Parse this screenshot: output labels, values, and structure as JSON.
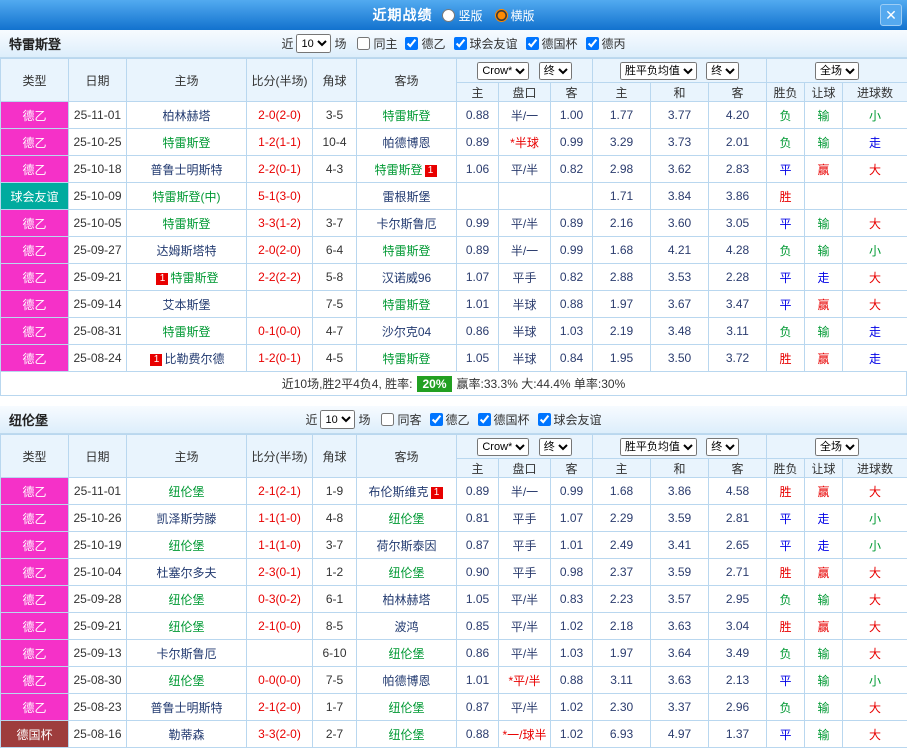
{
  "titlebar": {
    "title": "近期战绩",
    "layout_options": [
      {
        "label": "竖版",
        "selected": false
      },
      {
        "label": "横版",
        "selected": true
      }
    ],
    "close_label": "✕"
  },
  "filter_labels": {
    "near": "近",
    "games": "场"
  },
  "table_header": {
    "col_type": "类型",
    "col_date": "日期",
    "col_home": "主场",
    "col_score": "比分(半场)",
    "col_corner": "角球",
    "col_away": "客场",
    "odds_source": "Crow*",
    "odds_final": "终",
    "avg_source": "胜平负均值",
    "avg_final": "终",
    "scope": "全场",
    "sub_home": "主",
    "sub_line": "盘口",
    "sub_away": "客",
    "sub_avg_home": "主",
    "sub_avg_draw": "和",
    "sub_avg_away": "客",
    "sub_result": "胜负",
    "sub_handicap": "让球",
    "sub_goals": "进球数"
  },
  "colors": {
    "league": {
      "德乙": "#f531c8",
      "球会友谊": "#00ab9f",
      "德国杯": "#9e3d3d"
    },
    "outcome": {
      "胜": "#e80000",
      "平": "#0000e6",
      "负": "#009933",
      "赢": "#e80000",
      "输": "#009933",
      "走": "#0000e6",
      "大": "#e80000",
      "小": "#009933"
    },
    "team_highlight": "#009933",
    "team_normal": "#223a70",
    "score": "#e80000",
    "line_star": "#e80000",
    "badge_bg": "#e80000",
    "rate_badge_bg": "#22a022"
  },
  "sections": [
    {
      "team": "特雷斯登",
      "match_count": "10",
      "checkboxes": [
        {
          "label": "同主",
          "checked": false
        },
        {
          "label": "德乙",
          "checked": true
        },
        {
          "label": "球会友谊",
          "checked": true
        },
        {
          "label": "德国杯",
          "checked": true
        },
        {
          "label": "德丙",
          "checked": true
        }
      ],
      "rows": [
        {
          "league": "德乙",
          "date": "25-11-01",
          "home": {
            "name": "柏林赫塔",
            "highlight": false
          },
          "score": "2-0(2-0)",
          "corners": "3-5",
          "away": {
            "name": "特雷斯登",
            "highlight": true
          },
          "odds": [
            "0.88",
            "半/一",
            "1.00"
          ],
          "line_red": false,
          "avg": [
            "1.77",
            "3.77",
            "4.20"
          ],
          "result": "负",
          "handicap": "输",
          "goals": "小"
        },
        {
          "league": "德乙",
          "date": "25-10-25",
          "home": {
            "name": "特雷斯登",
            "highlight": true
          },
          "score": "1-2(1-1)",
          "corners": "10-4",
          "away": {
            "name": "帕德博恩",
            "highlight": false
          },
          "odds": [
            "0.89",
            "*半球",
            "0.99"
          ],
          "line_red": true,
          "avg": [
            "3.29",
            "3.73",
            "2.01"
          ],
          "result": "负",
          "handicap": "输",
          "goals": "走"
        },
        {
          "league": "德乙",
          "date": "25-10-18",
          "home": {
            "name": "普鲁士明斯特",
            "highlight": false
          },
          "score": "2-2(0-1)",
          "corners": "4-3",
          "away": {
            "name": "特雷斯登",
            "highlight": true,
            "badge": "1",
            "badge_pos": "after"
          },
          "odds": [
            "1.06",
            "平/半",
            "0.82"
          ],
          "line_red": false,
          "avg": [
            "2.98",
            "3.62",
            "2.83"
          ],
          "result": "平",
          "handicap": "赢",
          "goals": "大"
        },
        {
          "league": "球会友谊",
          "date": "25-10-09",
          "home": {
            "name": "特雷斯登(中)",
            "highlight": true
          },
          "score": "5-1(3-0)",
          "corners": "",
          "away": {
            "name": "雷根斯堡",
            "highlight": false
          },
          "odds": [
            "",
            "",
            ""
          ],
          "line_red": false,
          "avg": [
            "1.71",
            "3.84",
            "3.86"
          ],
          "result": "胜",
          "handicap": "",
          "goals": ""
        },
        {
          "league": "德乙",
          "date": "25-10-05",
          "home": {
            "name": "特雷斯登",
            "highlight": true
          },
          "score": "3-3(1-2)",
          "corners": "3-7",
          "away": {
            "name": "卡尔斯鲁厄",
            "highlight": false
          },
          "odds": [
            "0.99",
            "平/半",
            "0.89"
          ],
          "line_red": false,
          "avg": [
            "2.16",
            "3.60",
            "3.05"
          ],
          "result": "平",
          "handicap": "输",
          "goals": "大"
        },
        {
          "league": "德乙",
          "date": "25-09-27",
          "home": {
            "name": "达姆斯塔特",
            "highlight": false
          },
          "score": "2-0(2-0)",
          "corners": "6-4",
          "away": {
            "name": "特雷斯登",
            "highlight": true
          },
          "odds": [
            "0.89",
            "半/一",
            "0.99"
          ],
          "line_red": false,
          "avg": [
            "1.68",
            "4.21",
            "4.28"
          ],
          "result": "负",
          "handicap": "输",
          "goals": "小"
        },
        {
          "league": "德乙",
          "date": "25-09-21",
          "home": {
            "name": "特雷斯登",
            "highlight": true,
            "badge": "1",
            "badge_pos": "before"
          },
          "score": "2-2(2-2)",
          "corners": "5-8",
          "away": {
            "name": "汉诺威96",
            "highlight": false
          },
          "odds": [
            "1.07",
            "平手",
            "0.82"
          ],
          "line_red": false,
          "avg": [
            "2.88",
            "3.53",
            "2.28"
          ],
          "result": "平",
          "handicap": "走",
          "goals": "大"
        },
        {
          "league": "德乙",
          "date": "25-09-14",
          "home": {
            "name": "艾本斯堡",
            "highlight": false
          },
          "score": "",
          "corners": "7-5",
          "away": {
            "name": "特雷斯登",
            "highlight": true
          },
          "odds": [
            "1.01",
            "半球",
            "0.88"
          ],
          "line_red": false,
          "avg": [
            "1.97",
            "3.67",
            "3.47"
          ],
          "result": "平",
          "handicap": "赢",
          "goals": "大"
        },
        {
          "league": "德乙",
          "date": "25-08-31",
          "home": {
            "name": "特雷斯登",
            "highlight": true
          },
          "score": "0-1(0-0)",
          "corners": "4-7",
          "away": {
            "name": "沙尔克04",
            "highlight": false
          },
          "odds": [
            "0.86",
            "半球",
            "1.03"
          ],
          "line_red": false,
          "avg": [
            "2.19",
            "3.48",
            "3.11"
          ],
          "result": "负",
          "handicap": "输",
          "goals": "走"
        },
        {
          "league": "德乙",
          "date": "25-08-24",
          "home": {
            "name": "比勒费尔德",
            "highlight": false,
            "badge": "1",
            "badge_pos": "before"
          },
          "score": "1-2(0-1)",
          "corners": "4-5",
          "away": {
            "name": "特雷斯登",
            "highlight": true
          },
          "odds": [
            "1.05",
            "半球",
            "0.84"
          ],
          "line_red": false,
          "avg": [
            "1.95",
            "3.50",
            "3.72"
          ],
          "result": "胜",
          "handicap": "赢",
          "goals": "走"
        }
      ],
      "summary": {
        "text_before": "近10场,胜2平4负4, 胜率:",
        "rate": "20%",
        "text_after": "赢率:33.3% 大:44.4% 单率:30%"
      }
    },
    {
      "team": "纽伦堡",
      "match_count": "10",
      "checkboxes": [
        {
          "label": "同客",
          "checked": false
        },
        {
          "label": "德乙",
          "checked": true
        },
        {
          "label": "德国杯",
          "checked": true
        },
        {
          "label": "球会友谊",
          "checked": true
        }
      ],
      "rows": [
        {
          "league": "德乙",
          "date": "25-11-01",
          "home": {
            "name": "纽伦堡",
            "highlight": true
          },
          "score": "2-1(2-1)",
          "corners": "1-9",
          "away": {
            "name": "布伦斯维克",
            "highlight": false,
            "badge": "1",
            "badge_pos": "after"
          },
          "odds": [
            "0.89",
            "半/一",
            "0.99"
          ],
          "line_red": false,
          "avg": [
            "1.68",
            "3.86",
            "4.58"
          ],
          "result": "胜",
          "handicap": "赢",
          "goals": "大"
        },
        {
          "league": "德乙",
          "date": "25-10-26",
          "home": {
            "name": "凯泽斯劳滕",
            "highlight": false
          },
          "score": "1-1(1-0)",
          "corners": "4-8",
          "away": {
            "name": "纽伦堡",
            "highlight": true
          },
          "odds": [
            "0.81",
            "平手",
            "1.07"
          ],
          "line_red": false,
          "avg": [
            "2.29",
            "3.59",
            "2.81"
          ],
          "result": "平",
          "handicap": "走",
          "goals": "小"
        },
        {
          "league": "德乙",
          "date": "25-10-19",
          "home": {
            "name": "纽伦堡",
            "highlight": true
          },
          "score": "1-1(1-0)",
          "corners": "3-7",
          "away": {
            "name": "荷尔斯泰因",
            "highlight": false
          },
          "odds": [
            "0.87",
            "平手",
            "1.01"
          ],
          "line_red": false,
          "avg": [
            "2.49",
            "3.41",
            "2.65"
          ],
          "result": "平",
          "handicap": "走",
          "goals": "小"
        },
        {
          "league": "德乙",
          "date": "25-10-04",
          "home": {
            "name": "杜塞尔多夫",
            "highlight": false
          },
          "score": "2-3(0-1)",
          "corners": "1-2",
          "away": {
            "name": "纽伦堡",
            "highlight": true
          },
          "odds": [
            "0.90",
            "平手",
            "0.98"
          ],
          "line_red": false,
          "avg": [
            "2.37",
            "3.59",
            "2.71"
          ],
          "result": "胜",
          "handicap": "赢",
          "goals": "大"
        },
        {
          "league": "德乙",
          "date": "25-09-28",
          "home": {
            "name": "纽伦堡",
            "highlight": true
          },
          "score": "0-3(0-2)",
          "corners": "6-1",
          "away": {
            "name": "柏林赫塔",
            "highlight": false
          },
          "odds": [
            "1.05",
            "平/半",
            "0.83"
          ],
          "line_red": false,
          "avg": [
            "2.23",
            "3.57",
            "2.95"
          ],
          "result": "负",
          "handicap": "输",
          "goals": "大"
        },
        {
          "league": "德乙",
          "date": "25-09-21",
          "home": {
            "name": "纽伦堡",
            "highlight": true
          },
          "score": "2-1(0-0)",
          "corners": "8-5",
          "away": {
            "name": "波鸿",
            "highlight": false
          },
          "odds": [
            "0.85",
            "平/半",
            "1.02"
          ],
          "line_red": false,
          "avg": [
            "2.18",
            "3.63",
            "3.04"
          ],
          "result": "胜",
          "handicap": "赢",
          "goals": "大"
        },
        {
          "league": "德乙",
          "date": "25-09-13",
          "home": {
            "name": "卡尔斯鲁厄",
            "highlight": false
          },
          "score": "",
          "corners": "6-10",
          "away": {
            "name": "纽伦堡",
            "highlight": true
          },
          "odds": [
            "0.86",
            "平/半",
            "1.03"
          ],
          "line_red": false,
          "avg": [
            "1.97",
            "3.64",
            "3.49"
          ],
          "result": "负",
          "handicap": "输",
          "goals": "大"
        },
        {
          "league": "德乙",
          "date": "25-08-30",
          "home": {
            "name": "纽伦堡",
            "highlight": true
          },
          "score": "0-0(0-0)",
          "corners": "7-5",
          "away": {
            "name": "帕德博恩",
            "highlight": false
          },
          "odds": [
            "1.01",
            "*平/半",
            "0.88"
          ],
          "line_red": true,
          "avg": [
            "3.11",
            "3.63",
            "2.13"
          ],
          "result": "平",
          "handicap": "输",
          "goals": "小"
        },
        {
          "league": "德乙",
          "date": "25-08-23",
          "home": {
            "name": "普鲁士明斯特",
            "highlight": false
          },
          "score": "2-1(2-0)",
          "corners": "1-7",
          "away": {
            "name": "纽伦堡",
            "highlight": true
          },
          "odds": [
            "0.87",
            "平/半",
            "1.02"
          ],
          "line_red": false,
          "avg": [
            "2.30",
            "3.37",
            "2.96"
          ],
          "result": "负",
          "handicap": "输",
          "goals": "大"
        },
        {
          "league": "德国杯",
          "date": "25-08-16",
          "home": {
            "name": "勒蒂森",
            "highlight": false
          },
          "score": "3-3(2-0)",
          "corners": "2-7",
          "away": {
            "name": "纽伦堡",
            "highlight": true
          },
          "odds": [
            "0.88",
            "*一/球半",
            "1.02"
          ],
          "line_red": true,
          "avg": [
            "6.93",
            "4.97",
            "1.37"
          ],
          "result": "平",
          "handicap": "输",
          "goals": "大"
        }
      ],
      "summary": null
    }
  ]
}
